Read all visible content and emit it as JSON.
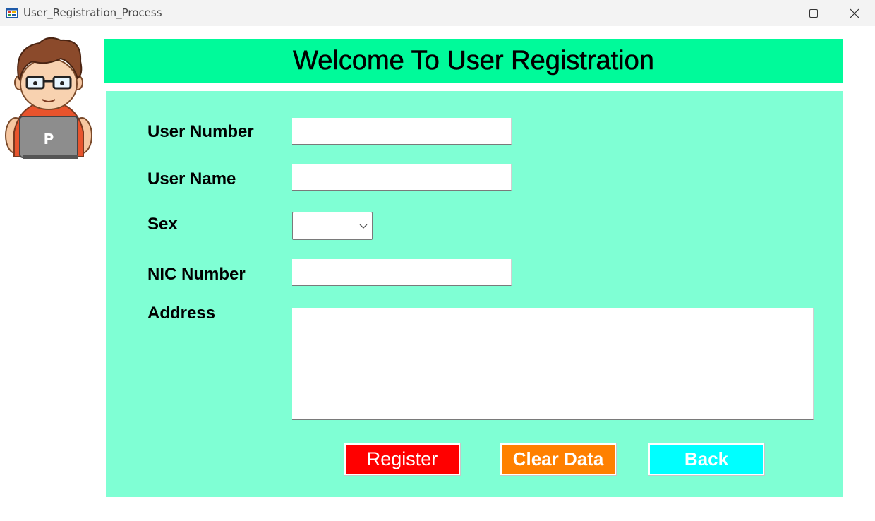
{
  "window": {
    "title": "User_Registration_Process",
    "icon": "app-window-icon",
    "controls": [
      "minimize-icon",
      "maximize-icon",
      "close-icon"
    ]
  },
  "banner": {
    "title": "Welcome To User Registration",
    "color": "#00fa9a"
  },
  "form": {
    "background": "#7fffd4",
    "user_number": {
      "label": "User Number",
      "value": ""
    },
    "user_name": {
      "label": "User Name",
      "value": ""
    },
    "sex": {
      "label": "Sex",
      "selected": ""
    },
    "nic_number": {
      "label": "NIC Number",
      "value": ""
    },
    "address": {
      "label": "Address",
      "value": ""
    }
  },
  "buttons": {
    "register": {
      "label": "Register",
      "color": "#ff0000"
    },
    "clear": {
      "label": "Clear Data",
      "color": "#ff8000"
    },
    "back": {
      "label": "Back",
      "color": "#00ffff"
    }
  },
  "avatar": {
    "icon": "programmer-avatar-icon",
    "laptop_letter": "P"
  }
}
